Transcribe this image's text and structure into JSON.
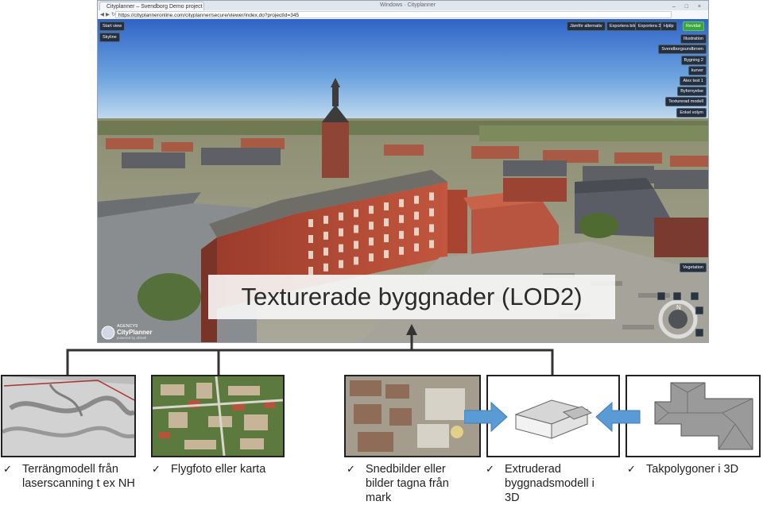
{
  "browser": {
    "tab_title": "Cityplanner – Svendborg Demo project - Google Chrome",
    "url": "https://cityplanneronline.com/cityplanner/secure/viewer/index.do?projectId=345",
    "watermark": "Windows · Cityplanner",
    "window_controls": "– □ ×"
  },
  "viewer": {
    "left_buttons": [
      "Start view",
      "Skyline"
    ],
    "top_buttons": [
      "Jämför alternativ",
      "Exportera bild",
      "Exportera 3D",
      "Hjälp",
      "Revidat"
    ],
    "layer_buttons": [
      "Illustration",
      "Svendborgsundbroen",
      "Bygning 2",
      "kurver",
      "Alex test 1",
      "Byfornyelse",
      "Texturerad modell",
      "Enkel volym"
    ],
    "bottom_right_button": "Vegetation",
    "logo_brand": "AGENCY9",
    "logo_product": "CityPlanner",
    "logo_sub": "powered by ahlsell",
    "compass_letters": "N E S W"
  },
  "caption": "Texturerade byggnader (LOD2)",
  "sources": [
    {
      "check": "✓",
      "lines": [
        "Terrängmodell från",
        "laserscanning t ex NH"
      ]
    },
    {
      "check": "✓",
      "lines": [
        "Flygfoto eller karta"
      ]
    },
    {
      "check": "✓",
      "lines": [
        "Snedbilder eller",
        "bilder tagna från",
        "mark"
      ]
    },
    {
      "check": "✓",
      "lines": [
        "Extruderad",
        "byggnadsmodell i",
        "3D"
      ]
    },
    {
      "check": "✓",
      "lines": [
        "Takpolygoner i 3D"
      ]
    }
  ],
  "colors": {
    "arrow": "#5b9bd5",
    "connector": "#333333",
    "sky_top": "#3b6fcf",
    "brick": "#b04a37"
  }
}
